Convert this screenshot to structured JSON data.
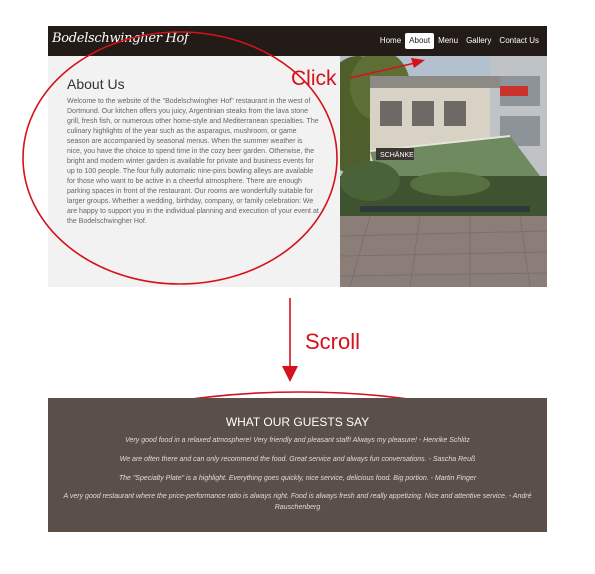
{
  "navbar": {
    "brand": "Bodelschwingher Hof",
    "items": [
      "Home",
      "About",
      "Menu",
      "Gallery",
      "Contact Us"
    ],
    "active": "About"
  },
  "about": {
    "title": "About Us",
    "text": "Welcome to the website of the \"Bodelschwingher Hof\" restaurant in the west of Dortmund. Our kitchen offers you juicy, Argentinian steaks from the lava stone grill, fresh fish, or numerous other home-style and Mediterranean specialties. The culinary highlights of the year such as the asparagus, mushroom, or game season are accompanied by seasonal menus. When the summer weather is nice, you have the choice to spend time in the cozy beer garden. Otherwise, the bright and modern winter garden is available for private and business events for up to 100 people. The four fully automatic nine-pins bowling alleys are available for those who want to be active in a cheerful atmosphere. There are enough parking spaces in front of the restaurant. Our rooms are wonderfully suitable for larger groups. Whether a wedding, birthday, company, or family celebration: We are happy to support you in the individual planning and execution of your event at the Bodelschwingher Hof."
  },
  "photo": {
    "sign_text": "SCHÄNKE"
  },
  "annotations": {
    "click": "Click",
    "scroll": "Scroll",
    "color": "#d4121a"
  },
  "testimonials": {
    "title": "WHAT OUR GUESTS SAY",
    "quotes": [
      "Very good food in a relaxed atmosphere! Very friendly and pleasant staff! Always my pleasure! - Henrike Schlitz",
      "We are often there and can only recommend the food. Great service and always fun conversations. - Sascha Reuß",
      "The \"Specialty Plate\" is a highlight. Everything goes quickly, nice service, delicious food. Big portion. - Martin Finger",
      "A very good restaurant where the price-performance ratio is always right. Food is always fresh and really appetizing. Nice and attentive service. - André Rauschenberg"
    ]
  }
}
